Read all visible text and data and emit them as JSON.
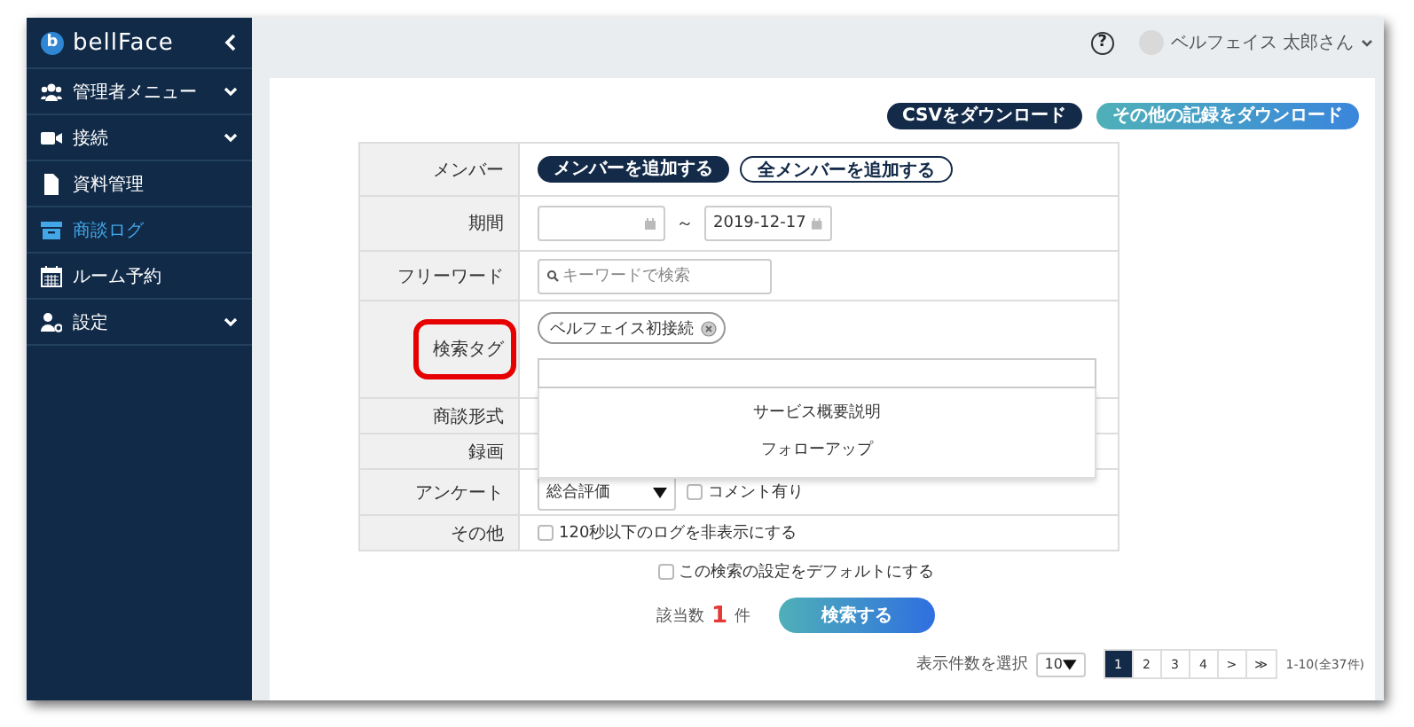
{
  "sidebar": {
    "brand": "bellFace",
    "logo_letter": "b",
    "items": [
      {
        "label": "管理者メニュー",
        "expandable": true,
        "selected": false
      },
      {
        "label": "接続",
        "expandable": true,
        "selected": false
      },
      {
        "label": "資料管理",
        "expandable": false,
        "selected": false
      },
      {
        "label": "商談ログ",
        "expandable": false,
        "selected": true
      },
      {
        "label": "ルーム予約",
        "expandable": false,
        "selected": false
      },
      {
        "label": "設定",
        "expandable": true,
        "selected": false
      }
    ]
  },
  "header": {
    "help": "?",
    "user": "ベルフェイス 太郎さん"
  },
  "actions": [
    {
      "label": "CSVをダウンロード",
      "kind": "dark"
    },
    {
      "label": "その他の記録をダウンロード",
      "kind": "teal"
    }
  ],
  "form": {
    "rows": [
      {
        "label": "メンバー",
        "kind": "buttons",
        "highlighted": false,
        "buttons": [
          {
            "label": "メンバーを追加する",
            "kind": "dark"
          },
          {
            "label": "全メンバーを追加する",
            "kind": "outline"
          }
        ]
      },
      {
        "label": "期間",
        "kind": "date_range",
        "highlighted": false,
        "from": "",
        "separator": "～",
        "to": "2019-12-17"
      },
      {
        "label": "フリーワード",
        "kind": "search",
        "highlighted": false,
        "placeholder": "キーワードで検索"
      },
      {
        "label": "検索タグ",
        "kind": "tags",
        "highlighted": true,
        "tags": [
          "ベルフェイス初接続"
        ],
        "options": [
          "サービス概要説明",
          "フォローアップ"
        ]
      },
      {
        "label": "商談形式",
        "kind": "empty",
        "highlighted": false
      },
      {
        "label": "録画",
        "kind": "empty",
        "highlighted": false
      },
      {
        "label": "アンケート",
        "kind": "survey",
        "highlighted": false,
        "select": "総合評価",
        "checkbox": {
          "label": "コメント有り",
          "checked": false
        }
      },
      {
        "label": "その他",
        "kind": "checkbox",
        "highlighted": false,
        "checkbox": {
          "label": "120秒以下のログを非表示にする",
          "checked": false
        }
      }
    ]
  },
  "default_checkbox": {
    "label": "この検索の設定をデフォルトにする",
    "checked": false
  },
  "result": {
    "label": "該当数",
    "count": "1",
    "unit": "件"
  },
  "search_button": "検索する",
  "pagination": {
    "per_page_label": "表示件数を選択",
    "per_page": "10",
    "pages": [
      {
        "label": "1",
        "selected": true
      },
      {
        "label": "2",
        "selected": false
      },
      {
        "label": "3",
        "selected": false
      },
      {
        "label": "4",
        "selected": false
      },
      {
        "label": ">",
        "selected": false
      },
      {
        "label": "≫",
        "selected": false
      }
    ],
    "range": "1-10(全37件)"
  }
}
